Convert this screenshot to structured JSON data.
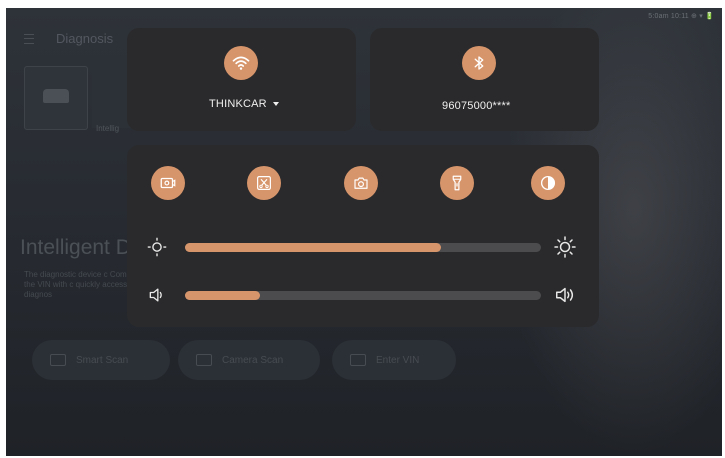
{
  "status_bar": {
    "text": "5:0am 10:11 ⊕ ▾ 🔋"
  },
  "background": {
    "title": "Diagnosis",
    "card_caption": "Intellig",
    "heading": "Intelligent D",
    "description": "The diagnostic device c Compare the VIN with c quickly access diagnos",
    "buttons": [
      {
        "label": "Smart Scan",
        "icon": "car-icon"
      },
      {
        "label": "Camera Scan",
        "icon": "scan-icon"
      },
      {
        "label": "Enter VIN",
        "icon": "pen-icon"
      }
    ]
  },
  "quick_panel": {
    "wifi": {
      "label": "THINKCAR",
      "icon": "wifi-icon"
    },
    "bluetooth": {
      "label": "96075000****",
      "icon": "bluetooth-icon"
    },
    "shortcuts": [
      {
        "name": "screen-record-icon"
      },
      {
        "name": "screenshot-icon"
      },
      {
        "name": "camera-icon"
      },
      {
        "name": "flashlight-icon"
      },
      {
        "name": "contrast-icon"
      }
    ],
    "brightness": {
      "level": 0.72,
      "min_icon": "brightness-low-icon",
      "max_icon": "brightness-high-icon"
    },
    "volume": {
      "level": 0.21,
      "min_icon": "volume-low-icon",
      "max_icon": "volume-high-icon"
    },
    "accent_color": "#d7956b"
  }
}
